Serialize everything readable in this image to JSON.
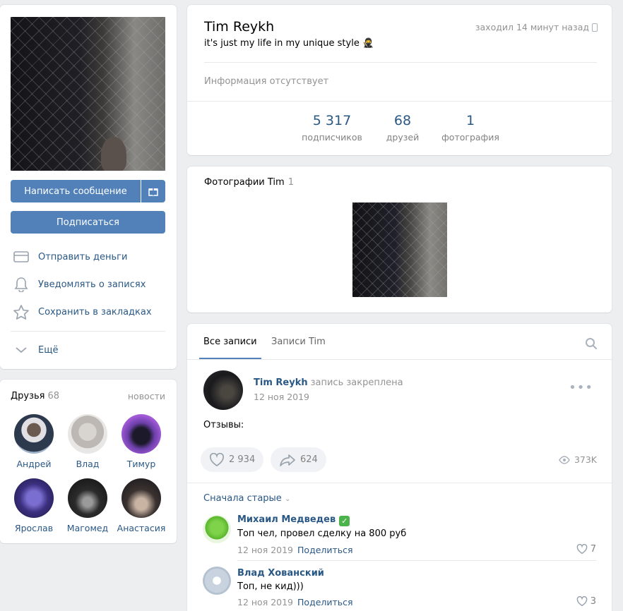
{
  "profile": {
    "message_button": "Написать сообщение",
    "subscribe_button": "Подписаться",
    "menu": [
      {
        "label": "Отправить деньги",
        "icon": "card-icon"
      },
      {
        "label": "Уведомлять о записях",
        "icon": "bell-icon"
      },
      {
        "label": "Сохранить в закладках",
        "icon": "star-icon"
      }
    ],
    "more_label": "Ещё"
  },
  "friends": {
    "title": "Друзья",
    "count": "68",
    "news_link": "новости",
    "items": [
      {
        "name": "Андрей"
      },
      {
        "name": "Влад"
      },
      {
        "name": "Тимур"
      },
      {
        "name": "Ярослав"
      },
      {
        "name": "Магомед"
      },
      {
        "name": "Анастасия"
      }
    ]
  },
  "header": {
    "name": "Tim Reykh",
    "status": "it's just my life in my unique style 🥷",
    "last_seen": "заходил 14 минут назад",
    "info_absent": "Информация отсутствует",
    "counters": [
      {
        "value": "5 317",
        "label": "подписчиков"
      },
      {
        "value": "68",
        "label": "друзей"
      },
      {
        "value": "1",
        "label": "фотография"
      }
    ]
  },
  "photos": {
    "title": "Фотографии Tim",
    "count": "1"
  },
  "wall": {
    "tabs": [
      "Все записи",
      "Записи Tim"
    ],
    "post": {
      "author": "Tim Reykh",
      "pinned": "запись закреплена",
      "date": "12 ноя 2019",
      "text": "Отзывы:",
      "likes": "2 934",
      "shares": "624",
      "views": "373K"
    },
    "sort_label": "Сначала старые",
    "comments": [
      {
        "author": "Михаил Медведев",
        "verified_mark": "✓",
        "text": "Топ чел, провел сделку на 800 руб",
        "date": "12 ноя 2019",
        "share": "Поделиться",
        "likes": "7"
      },
      {
        "author": "Влад Хованский",
        "text": "Топ, не кид)))",
        "date": "12 ноя 2019",
        "share": "Поделиться",
        "likes": "3"
      }
    ]
  }
}
